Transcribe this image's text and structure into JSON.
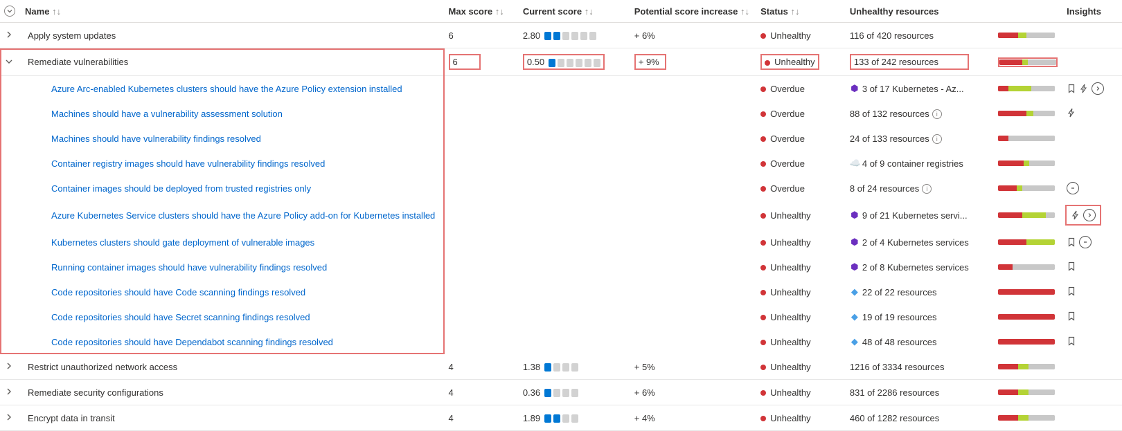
{
  "columns": {
    "name": "Name",
    "max": "Max score",
    "cur": "Current score",
    "pot": "Potential score increase",
    "status": "Status",
    "unh": "Unhealthy resources",
    "ins": "Insights"
  },
  "groups": [
    {
      "name": "Apply system updates",
      "expanded": false,
      "max": "6",
      "cur": "2.80",
      "cur_on": 2,
      "cur_tot": 6,
      "pot": "+ 6%",
      "status": "Unhealthy",
      "res": "116 of 420 resources",
      "bar": [
        35,
        15,
        50
      ],
      "children": [],
      "hl": false
    },
    {
      "name": "Remediate vulnerabilities",
      "expanded": true,
      "max": "6",
      "cur": "0.50",
      "cur_on": 1,
      "cur_tot": 6,
      "pot": "+ 9%",
      "status": "Unhealthy",
      "res": "133 of 242 resources",
      "bar": [
        40,
        10,
        50
      ],
      "hl": true,
      "children": [
        {
          "name": "Azure Arc-enabled Kubernetes clusters should have the Azure Policy extension installed",
          "status": "Overdue",
          "res_ico": "k8s",
          "res": "3 of 17 Kubernetes - Az...",
          "bar": [
            18,
            40,
            42
          ],
          "insights": [
            "bookmark",
            "lightning",
            "chev-circle"
          ]
        },
        {
          "name": "Machines should have a vulnerability assessment solution",
          "status": "Overdue",
          "res": "88 of 132 resources",
          "info": true,
          "bar": [
            50,
            12,
            38
          ],
          "insights": [
            "lightning"
          ]
        },
        {
          "name": "Machines should have vulnerability findings resolved",
          "status": "Overdue",
          "res": "24 of 133 resources",
          "info": true,
          "bar": [
            18,
            0,
            82
          ],
          "insights": []
        },
        {
          "name": "Container registry images should have vulnerability findings resolved",
          "status": "Overdue",
          "res_ico": "cloud",
          "res": "4 of 9 container registries",
          "bar": [
            44,
            10,
            46
          ],
          "insights": []
        },
        {
          "name": "Container images should be deployed from trusted registries only",
          "status": "Overdue",
          "res": "8 of 24 resources",
          "info": true,
          "bar": [
            32,
            10,
            58
          ],
          "insights": [
            "minus-circle"
          ]
        },
        {
          "name": "Azure Kubernetes Service clusters should have the Azure Policy add-on for Kubernetes installed",
          "status": "Unhealthy",
          "res_ico": "k8s",
          "res": "9 of 21 Kubernetes servi...",
          "bar": [
            42,
            42,
            16
          ],
          "insights": [
            "lightning",
            "chev-circle"
          ],
          "hl_ins": true
        },
        {
          "name": "Kubernetes clusters should gate deployment of vulnerable images",
          "status": "Unhealthy",
          "res_ico": "k8s",
          "res": "2 of 4 Kubernetes services",
          "bar": [
            50,
            50,
            0
          ],
          "insights": [
            "bookmark",
            "minus-circle"
          ]
        },
        {
          "name": "Running container images should have vulnerability findings resolved",
          "status": "Unhealthy",
          "res_ico": "k8s",
          "res": "2 of 8 Kubernetes services",
          "bar": [
            25,
            0,
            75
          ],
          "insights": [
            "bookmark"
          ]
        },
        {
          "name": "Code repositories should have Code scanning findings resolved",
          "status": "Unhealthy",
          "res_ico": "repo",
          "res": "22 of 22 resources",
          "bar": [
            100,
            0,
            0
          ],
          "insights": [
            "bookmark"
          ]
        },
        {
          "name": "Code repositories should have Secret scanning findings resolved",
          "status": "Unhealthy",
          "res_ico": "repo",
          "res": "19 of 19 resources",
          "bar": [
            100,
            0,
            0
          ],
          "insights": [
            "bookmark"
          ]
        },
        {
          "name": "Code repositories should have Dependabot scanning findings resolved",
          "status": "Unhealthy",
          "res_ico": "repo",
          "res": "48 of 48 resources",
          "bar": [
            100,
            0,
            0
          ],
          "insights": [
            "bookmark"
          ]
        }
      ]
    },
    {
      "name": "Restrict unauthorized network access",
      "expanded": false,
      "max": "4",
      "cur": "1.38",
      "cur_on": 1,
      "cur_tot": 4,
      "pot": "+ 5%",
      "status": "Unhealthy",
      "res": "1216 of 3334 resources",
      "bar": [
        35,
        18,
        47
      ],
      "children": [],
      "hl": false
    },
    {
      "name": "Remediate security configurations",
      "expanded": false,
      "max": "4",
      "cur": "0.36",
      "cur_on": 1,
      "cur_tot": 4,
      "pot": "+ 6%",
      "status": "Unhealthy",
      "res": "831 of 2286 resources",
      "bar": [
        35,
        18,
        47
      ],
      "children": [],
      "hl": false
    },
    {
      "name": "Encrypt data in transit",
      "expanded": false,
      "max": "4",
      "cur": "1.89",
      "cur_on": 2,
      "cur_tot": 4,
      "pot": "+ 4%",
      "status": "Unhealthy",
      "res": "460 of 1282 resources",
      "bar": [
        35,
        18,
        47
      ],
      "children": [],
      "hl": false
    }
  ]
}
